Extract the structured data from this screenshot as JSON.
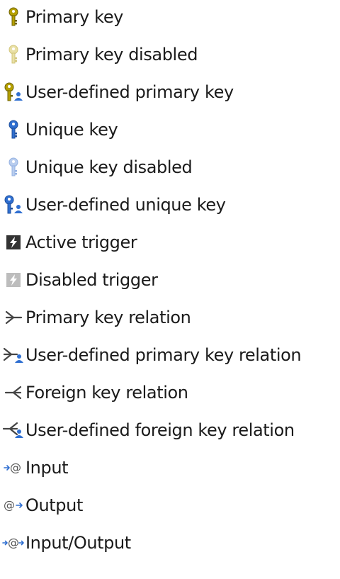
{
  "colors": {
    "key_primary": "#b5a000",
    "key_primary_dark": "#6e6200",
    "key_primary_disabled": "#e9e0a6",
    "key_unique": "#2f6fd1",
    "key_unique_dark": "#1d4e9c",
    "key_unique_disabled": "#b9cdee",
    "user_badge": "#2f6fd1",
    "trigger": "#333333",
    "trigger_disabled": "#bdbdbd",
    "relation": "#444444",
    "param": "#555555",
    "param_arrow": "#2f6fd1"
  },
  "legend": [
    {
      "icon": "primary-key-icon",
      "label": "Primary key"
    },
    {
      "icon": "primary-key-disabled-icon",
      "label": "Primary key disabled"
    },
    {
      "icon": "user-defined-primary-key-icon",
      "label": "User-defined primary key"
    },
    {
      "icon": "unique-key-icon",
      "label": "Unique key"
    },
    {
      "icon": "unique-key-disabled-icon",
      "label": "Unique key disabled"
    },
    {
      "icon": "user-defined-unique-key-icon",
      "label": "User-defined unique key"
    },
    {
      "icon": "active-trigger-icon",
      "label": "Active trigger"
    },
    {
      "icon": "disabled-trigger-icon",
      "label": "Disabled trigger"
    },
    {
      "icon": "primary-key-relation-icon",
      "label": "Primary key relation"
    },
    {
      "icon": "user-defined-primary-key-relation-icon",
      "label": "User-defined primary key relation"
    },
    {
      "icon": "foreign-key-relation-icon",
      "label": "Foreign key relation"
    },
    {
      "icon": "user-defined-foreign-key-relation-icon",
      "label": "User-defined foreign key relation"
    },
    {
      "icon": "input-parameter-icon",
      "label": "Input"
    },
    {
      "icon": "output-parameter-icon",
      "label": "Output"
    },
    {
      "icon": "input-output-parameter-icon",
      "label": "Input/Output"
    }
  ]
}
